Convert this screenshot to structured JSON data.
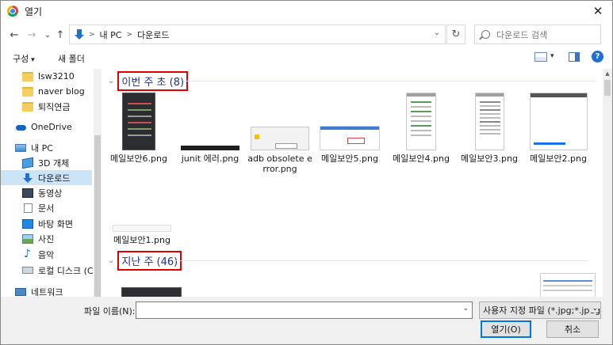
{
  "window": {
    "title": "열기",
    "close": "✕"
  },
  "nav": {
    "back": "←",
    "forward": "→",
    "recent": "⌄",
    "up": "↑",
    "breadcrumb": [
      "내 PC",
      "다운로드"
    ],
    "sep": ">",
    "refresh": "↻",
    "search_placeholder": "다운로드 검색"
  },
  "toolbar": {
    "organize": "구성",
    "new_folder": "새 폴더",
    "help": "?"
  },
  "sidebar": {
    "items": [
      {
        "label": "lsw3210",
        "icon": "folder-icon"
      },
      {
        "label": "naver blog",
        "icon": "folder-icon"
      },
      {
        "label": "퇴직연금",
        "icon": "folder-icon"
      },
      {
        "label": "OneDrive",
        "icon": "onedrive-icon"
      },
      {
        "label": "내 PC",
        "icon": "pc-icon"
      },
      {
        "label": "3D 개체",
        "icon": "3d-objects-icon"
      },
      {
        "label": "다운로드",
        "icon": "downloads-icon"
      },
      {
        "label": "동영상",
        "icon": "videos-icon"
      },
      {
        "label": "문서",
        "icon": "documents-icon"
      },
      {
        "label": "바탕 화면",
        "icon": "desktop-icon"
      },
      {
        "label": "사진",
        "icon": "pictures-icon"
      },
      {
        "label": "음악",
        "icon": "music-icon"
      },
      {
        "label": "로컬 디스크 (C:)",
        "icon": "disk-icon"
      },
      {
        "label": "네트워크",
        "icon": "network-icon"
      }
    ],
    "selected": "다운로드"
  },
  "groups": [
    {
      "title": "이번 주 초 (8)"
    },
    {
      "title": "지난 주 (46)"
    }
  ],
  "files": [
    {
      "name": "메일보안6.png"
    },
    {
      "name": "junit 에러.png"
    },
    {
      "name": "adb obsolete error.png"
    },
    {
      "name": "메일보안5.png"
    },
    {
      "name": "메일보안4.png"
    },
    {
      "name": "메일보안3.png"
    },
    {
      "name": "메일보안2.png"
    },
    {
      "name": "메일보안1.png"
    }
  ],
  "bottom": {
    "filename_label": "파일 이름(N):",
    "filename_value": "",
    "file_type": "사용자 지정 파일 (*.jpg;*.jpeg;*",
    "open_label": "열기(O)",
    "cancel_label": "취소"
  },
  "colors": {
    "accent": "#0078d7",
    "highlight_box": "#e00000",
    "group_title": "#1e3287",
    "selection": "#cce4f7"
  }
}
